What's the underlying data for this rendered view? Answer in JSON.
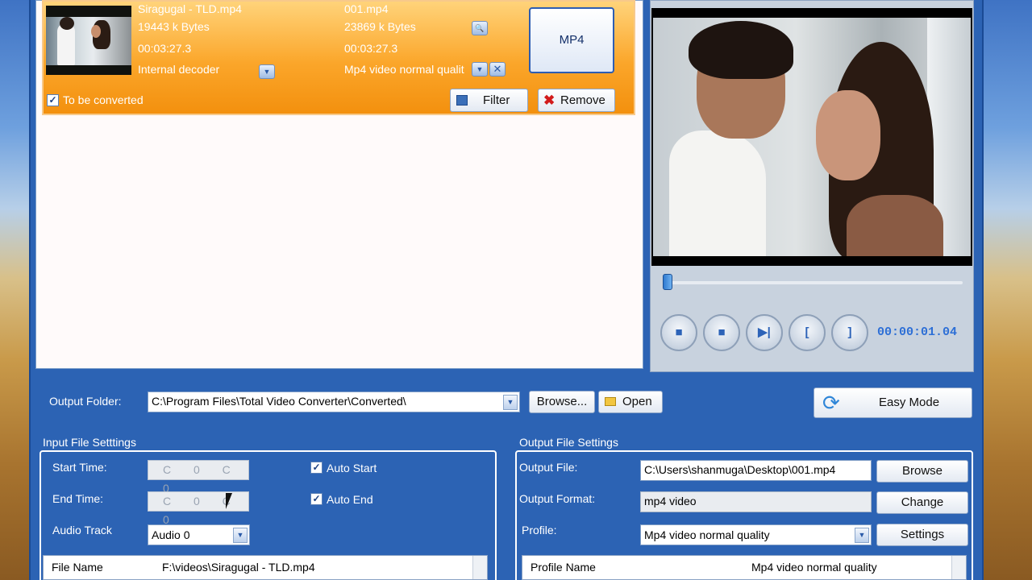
{
  "file_list": {
    "item": {
      "source_name": "Siragugal - TLD.mp4",
      "source_size": "19443 k Bytes",
      "source_duration": "00:03:27.3",
      "decoder": "Internal decoder",
      "output_name": "001.mp4",
      "output_size": "23869 k Bytes",
      "output_duration": "00:03:27.3",
      "output_profile": "Mp4 video normal qualit",
      "format_badge": "MP4",
      "to_be_converted_label": "To be converted",
      "to_be_converted_checked": true,
      "filter_label": "Filter",
      "remove_label": "Remove"
    }
  },
  "player": {
    "time": "00:00:01.04",
    "progress": 0.0,
    "buttons": [
      "stop-icon",
      "pause-icon",
      "next-frame-icon",
      "mark-in-icon",
      "mark-out-icon"
    ]
  },
  "output_folder": {
    "label": "Output Folder:",
    "value": "C:\\Program Files\\Total Video Converter\\Converted\\",
    "browse_label": "Browse...",
    "open_label": "Open"
  },
  "easy_mode_label": "Easy Mode",
  "input_settings": {
    "title": "Input File Setttings",
    "start_time_label": "Start Time:",
    "end_time_label": "End Time:",
    "start_time_value": "C 0 C 0",
    "end_time_value": "C 0 C 0",
    "auto_start_label": "Auto Start",
    "auto_end_label": "Auto End",
    "audio_track_label": "Audio Track",
    "audio_track_value": "Audio 0",
    "grid_key": "File Name",
    "grid_value": "F:\\videos\\Siragugal - TLD.mp4"
  },
  "output_settings": {
    "title": "Output File Settings",
    "output_file_label": "Output File:",
    "output_file_value": "C:\\Users\\shanmuga\\Desktop\\001.mp4",
    "browse_label": "Browse",
    "output_format_label": "Output Format:",
    "output_format_value": "mp4 video",
    "change_label": "Change",
    "profile_label": "Profile:",
    "profile_value": "Mp4 video normal quality",
    "settings_label": "Settings",
    "grid_key": "Profile Name",
    "grid_value": "Mp4 video normal quality"
  },
  "colors": {
    "window_blue": "#2c63b4",
    "item_orange": "#f7a020",
    "time_blue": "#2d6fd6"
  }
}
